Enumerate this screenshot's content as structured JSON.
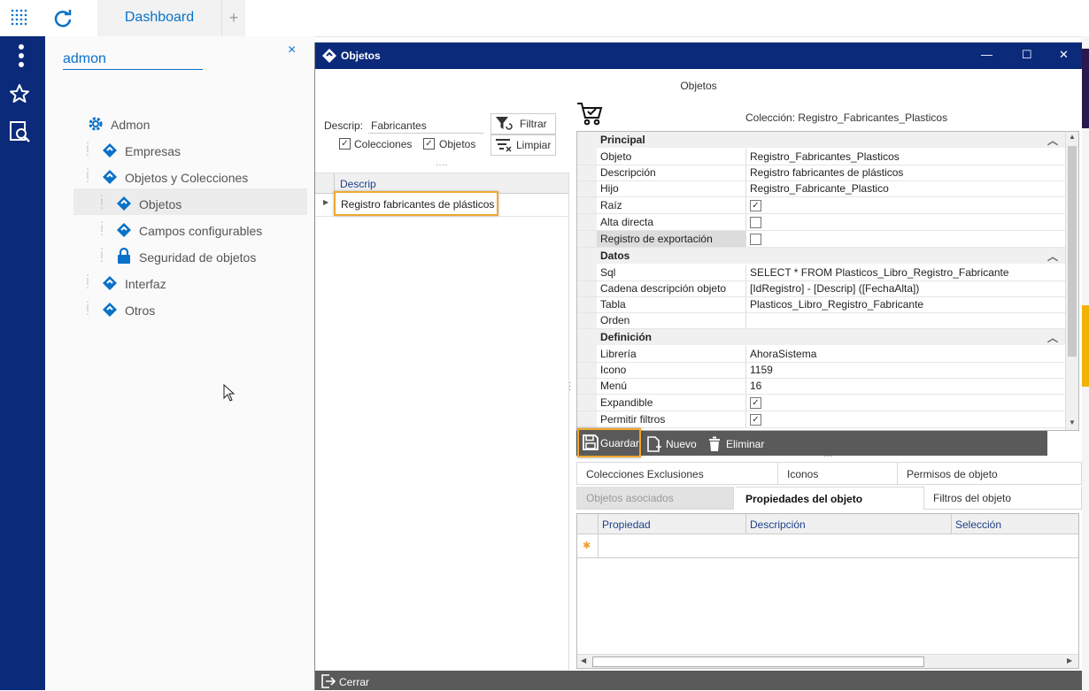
{
  "topbar": {
    "tab_label": "Dashboard",
    "add_tab": "+"
  },
  "sidebar": {
    "search_value": "admon",
    "clear": "×",
    "tree": {
      "root": "Admon",
      "items": [
        "Empresas",
        "Objetos y Colecciones",
        "Objetos",
        "Campos configurables",
        "Seguridad de objetos",
        "Interfaz",
        "Otros"
      ]
    }
  },
  "dialog": {
    "title": "Objetos",
    "subtitle": "Objetos",
    "window_controls": {
      "minimize": "—",
      "maximize": "☐",
      "close": "✕"
    },
    "filter": {
      "descrip_label": "Descrip:",
      "descrip_value": "Fabricantes",
      "filtrar": "Filtrar",
      "limpiar": "Limpiar",
      "colecciones": "Colecciones",
      "objetos": "Objetos",
      "colecciones_checked": true,
      "objetos_checked": true
    },
    "list": {
      "header": "Descrip",
      "rows": [
        "Registro fabricantes de plásticos"
      ]
    },
    "collection_label": "Colección: Registro_Fabricantes_Plasticos",
    "properties": {
      "sections": [
        {
          "name": "Principal",
          "rows": [
            {
              "key": "Objeto",
              "value": "Registro_Fabricantes_Plasticos"
            },
            {
              "key": "Descripción",
              "value": "Registro fabricantes de plásticos"
            },
            {
              "key": "Hijo",
              "value": "Registro_Fabricante_Plastico"
            },
            {
              "key": "Raíz",
              "check": true
            },
            {
              "key": "Alta directa",
              "check": false
            },
            {
              "key": "Registro de exportación",
              "check": false
            }
          ]
        },
        {
          "name": "Datos",
          "rows": [
            {
              "key": "Sql",
              "value": "SELECT * FROM Plasticos_Libro_Registro_Fabricante"
            },
            {
              "key": "Cadena descripción objeto",
              "value": "[IdRegistro] - [Descrip] ([FechaAlta])"
            },
            {
              "key": "Tabla",
              "value": "Plasticos_Libro_Registro_Fabricante"
            },
            {
              "key": "Orden",
              "value": ""
            }
          ]
        },
        {
          "name": "Definición",
          "rows": [
            {
              "key": "Librería",
              "value": "AhoraSistema"
            },
            {
              "key": "Icono",
              "value": "1159"
            },
            {
              "key": "Menú",
              "value": "16"
            },
            {
              "key": "Expandible",
              "check": true
            },
            {
              "key": "Permitir filtros",
              "check": true
            }
          ]
        }
      ]
    },
    "toolbar": {
      "guardar": "Guardar",
      "nuevo": "Nuevo",
      "eliminar": "Eliminar"
    },
    "tabs_row1": [
      "Colecciones Exclusiones",
      "Iconos",
      "Permisos de objeto"
    ],
    "tabs_row2": [
      "Objetos asociados",
      "Propiedades del objeto",
      "Filtros del objeto"
    ],
    "active_tab": "Propiedades del objeto",
    "table_headers": [
      "Propiedad",
      "Descripción",
      "Selección"
    ],
    "new_row_marker": "✱",
    "footer": {
      "cerrar": "Cerrar"
    }
  },
  "colors": {
    "brand_navy": "#0b2a7a",
    "accent_blue": "#0a71c9",
    "highlight": "#f0a830",
    "toolbar_bg": "#5a5a5a"
  }
}
